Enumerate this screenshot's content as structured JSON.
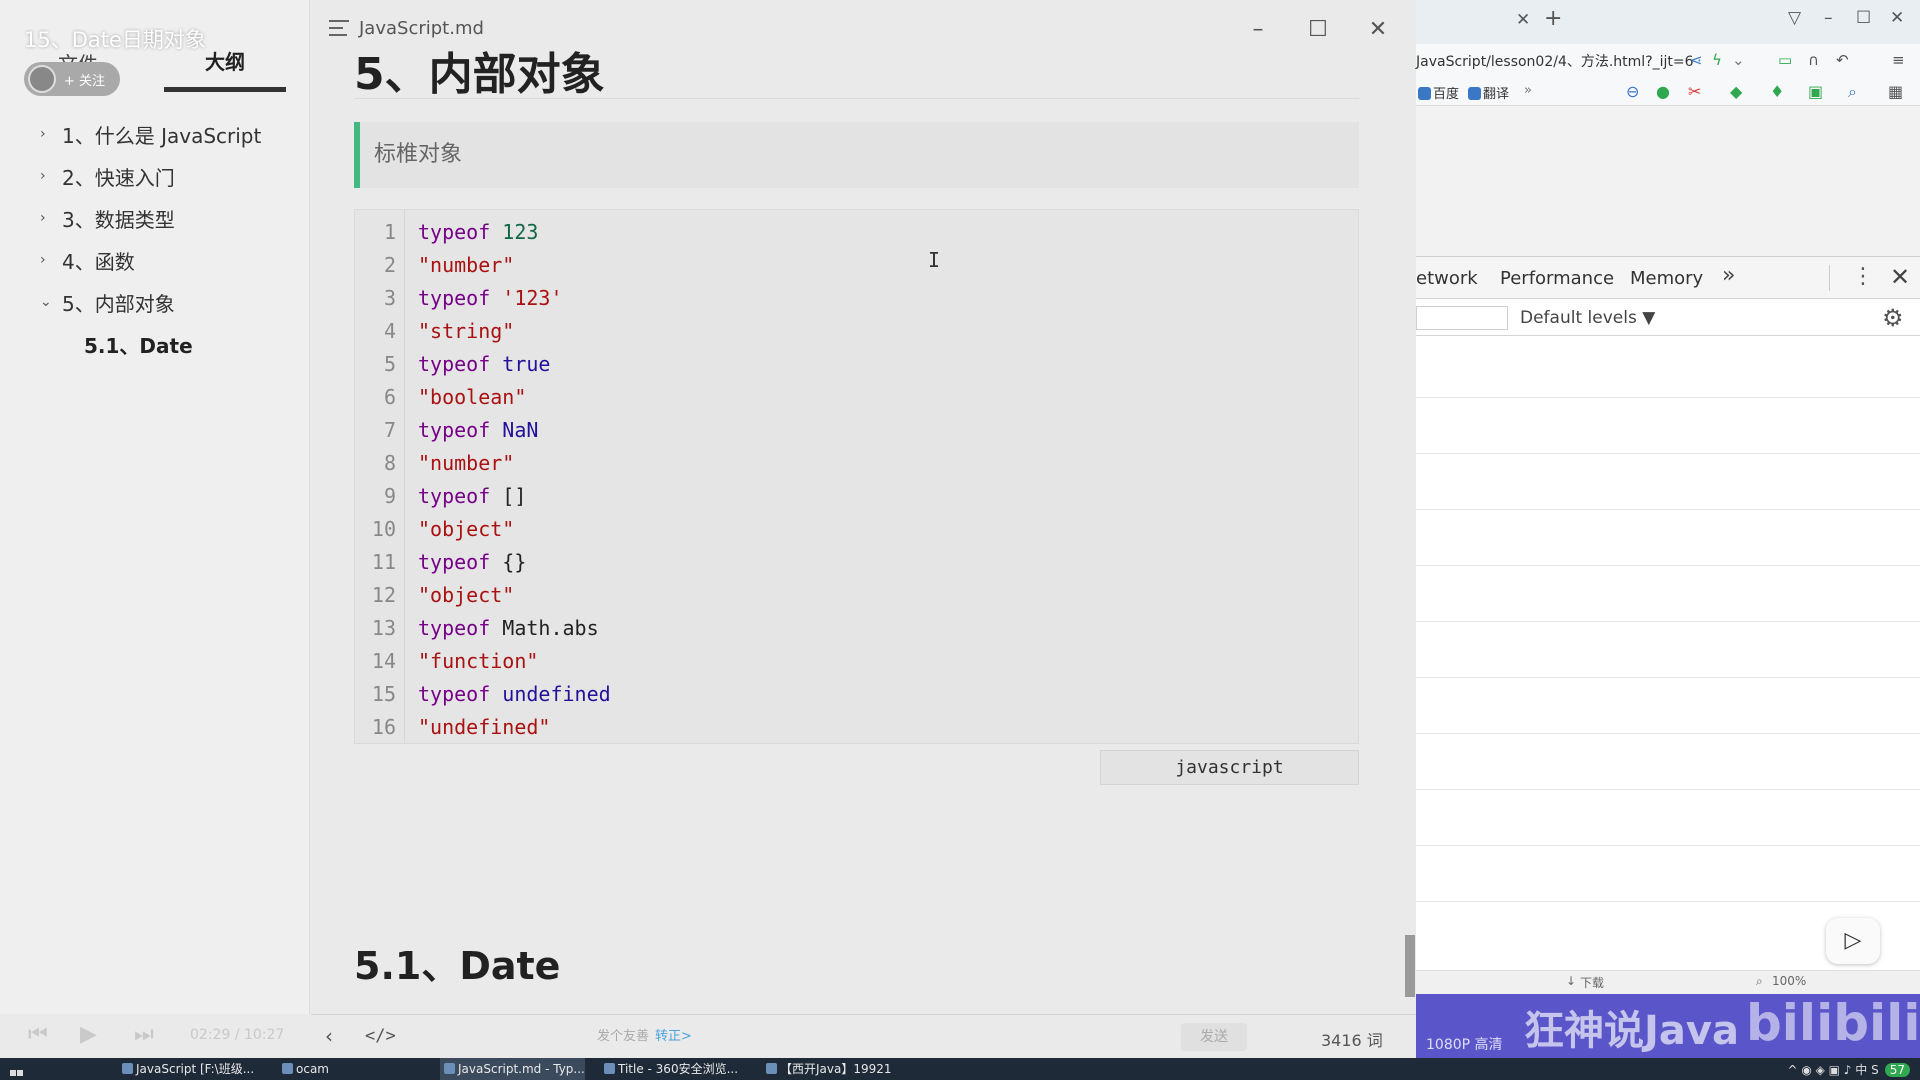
{
  "overlay": {
    "video_title": "15、Date日期对象",
    "follow_label": "+ 关注"
  },
  "sidebar": {
    "tab_file": "文件",
    "tab_outline": "大纲",
    "outline": [
      {
        "label": "1、什么是 JavaScript",
        "expanded": false
      },
      {
        "label": "2、快速入门",
        "expanded": false
      },
      {
        "label": "3、数据类型",
        "expanded": false
      },
      {
        "label": "4、函数",
        "expanded": false
      },
      {
        "label": "5、内部对象",
        "expanded": true
      },
      {
        "label": "5.1、Date",
        "child": true
      }
    ]
  },
  "editor": {
    "doc_title": "JavaScript.md",
    "heading": "5、内部对象",
    "quote": "标椎对象",
    "code_language": "javascript",
    "code_lines": [
      "typeof 123",
      "\"number\"",
      "typeof '123'",
      "\"string\"",
      "typeof true",
      "\"boolean\"",
      "typeof NaN",
      "\"number\"",
      "typeof []",
      "\"object\"",
      "typeof {}",
      "\"object\"",
      "typeof Math.abs",
      "\"function\"",
      "typeof undefined",
      "\"undefined\""
    ],
    "subheading": "5.1、Date",
    "word_count": "3416 词"
  },
  "browser": {
    "url": "JavaScript/lesson02/4、方法.html?_ijt=6",
    "bookmarks": [
      "百度",
      "翻译"
    ],
    "devtools": {
      "tabs": [
        "etwork",
        "Performance",
        "Memory"
      ],
      "more": "»",
      "levels": "Default levels ▼"
    },
    "status_download": "下载",
    "status_zoom": "100%"
  },
  "player": {
    "time": "02:29 / 10:27",
    "danmu_placeholder": "发个友善",
    "danmu_link": "转正>",
    "send_label": "发送",
    "quality": "1080P 高清",
    "watermark_text": "狂神说Java",
    "watermark_logo": "bilibili"
  },
  "taskbar": {
    "items": [
      "JavaScript [F:\\班级...",
      "ocam",
      "JavaScript.md - Typ...",
      "Title - 360安全浏览...",
      "【西开Java】19921"
    ],
    "tray_badge": "57"
  },
  "colors": {
    "keyword": "#770088",
    "number": "#116644",
    "string": "#aa1111",
    "atom": "#221199",
    "quote_border": "#42b983",
    "watermark_bar": "#5a56c9"
  }
}
